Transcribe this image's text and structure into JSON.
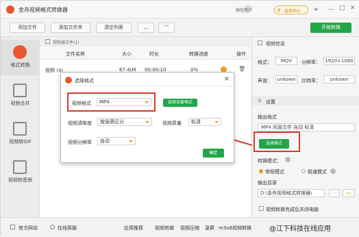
{
  "app": {
    "title": "金舟视频格式转换器",
    "user": "微信用户",
    "vip_label": "会员中心",
    "accent": "#22a548",
    "logo_color": "#e8572e",
    "highlight": "#d83a2b"
  },
  "toolbar": {
    "add_file": "添加文件",
    "add_folder": "添加文件夹",
    "clear_list": "清空列表",
    "start": "开始转换"
  },
  "sidebar": {
    "items": [
      {
        "label": "格式转换",
        "icon": "convert-icon"
      },
      {
        "label": "视频合并",
        "icon": "merge-icon"
      },
      {
        "label": "视频转GIF",
        "icon": "gif-icon"
      },
      {
        "label": "视频转音频",
        "icon": "audio-icon"
      }
    ]
  },
  "list": {
    "header_note": "视频源文件(1)",
    "columns": [
      "文件名称",
      "大小",
      "时长",
      "转换进度",
      "操作"
    ],
    "row": {
      "name": "视频 (4)",
      "size": "67.4(M",
      "duration": "00:00:10",
      "progress": "0%"
    }
  },
  "right": {
    "video_info_title": "视频信息",
    "format_label": "格式：",
    "format": "MOV",
    "resolution_label": "分辨率：",
    "resolution": "1920×1080",
    "channel_label": "声道：",
    "channel": "unkown",
    "bitrate_label": "比特率：",
    "bitrate": "unkown",
    "settings_title": "设置",
    "output_format_label": "输出格式",
    "output_format_value": "MP4 同源文件 自动 标清",
    "choose_format": "选择格式",
    "mode_label": "转换模式：",
    "mode_normal": "常规模式",
    "mode_fast": "极速模式",
    "output_dir_label": "输出目录",
    "output_dir": "D:\\金舟视频格式转换器\\",
    "shutdown_label": "视频转换完成后关闭电脑"
  },
  "status": {
    "website": "官方网站",
    "service": "在线客服",
    "apps_label": "应用推荐",
    "apps": [
      "视频剪辑",
      "视频压缩",
      "录屏",
      "m3u8视频转换"
    ],
    "watermark": "@江下科技在线应用"
  },
  "dialog": {
    "title": "选择格式",
    "format_label": "视频格式",
    "format_value": "MP4",
    "select_device": "选择设备格式",
    "clarity_label": "视频清晰度",
    "clarity_value": "按源质区分",
    "quality_label": "视频质量",
    "quality_value": "标清",
    "resolution_label": "视频分辨率",
    "resolution_value": "自动",
    "ok": "确定"
  }
}
